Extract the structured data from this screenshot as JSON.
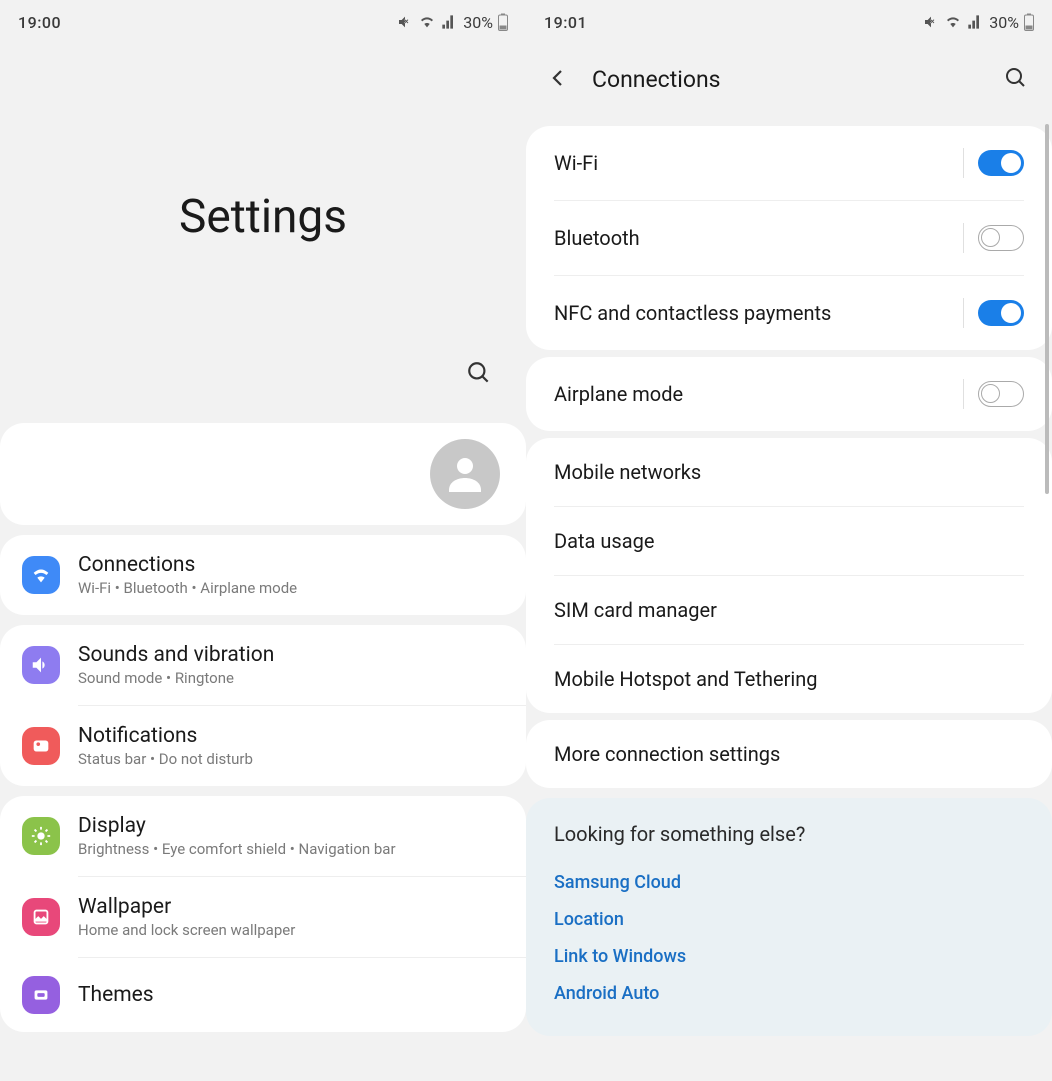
{
  "screen1": {
    "status": {
      "time": "19:00",
      "battery": "30%"
    },
    "title": "Settings",
    "items": [
      {
        "title": "Connections",
        "sub": "Wi-Fi  •  Bluetooth  •  Airplane mode"
      },
      {
        "title": "Sounds and vibration",
        "sub": "Sound mode  •  Ringtone"
      },
      {
        "title": "Notifications",
        "sub": "Status bar  •  Do not disturb"
      },
      {
        "title": "Display",
        "sub": "Brightness  •  Eye comfort shield  •  Navigation bar"
      },
      {
        "title": "Wallpaper",
        "sub": "Home and lock screen wallpaper"
      },
      {
        "title": "Themes",
        "sub": ""
      }
    ]
  },
  "screen2": {
    "status": {
      "time": "19:01",
      "battery": "30%"
    },
    "title": "Connections",
    "toggles": {
      "wifi": {
        "label": "Wi-Fi",
        "on": true
      },
      "bluetooth": {
        "label": "Bluetooth",
        "on": false
      },
      "nfc": {
        "label": "NFC and contactless payments",
        "on": true
      },
      "airplane": {
        "label": "Airplane mode",
        "on": false
      }
    },
    "links": {
      "mobile": "Mobile networks",
      "data": "Data usage",
      "sim": "SIM card manager",
      "hotspot": "Mobile Hotspot and Tethering",
      "more": "More connection settings"
    },
    "suggest": {
      "title": "Looking for something else?",
      "items": [
        "Samsung Cloud",
        "Location",
        "Link to Windows",
        "Android Auto"
      ]
    }
  }
}
